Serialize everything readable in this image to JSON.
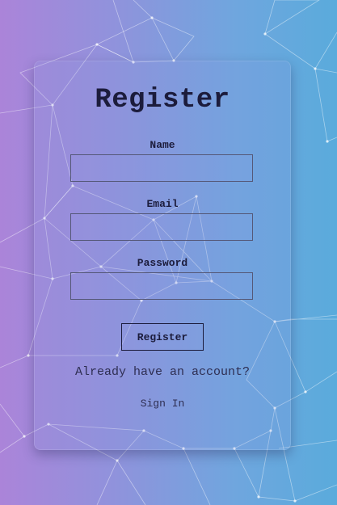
{
  "form": {
    "title": "Register",
    "fields": [
      {
        "label": "Name",
        "value": ""
      },
      {
        "label": "Email",
        "value": ""
      },
      {
        "label": "Password",
        "value": ""
      }
    ],
    "submit_label": "Register",
    "account_prompt": "Already have an account?",
    "signin_label": "Sign In"
  },
  "colors": {
    "gradient_start": "#ab84d9",
    "gradient_end": "#5aabdc",
    "text_dark": "#1c1c3c",
    "network_lines": "#ffffff"
  }
}
